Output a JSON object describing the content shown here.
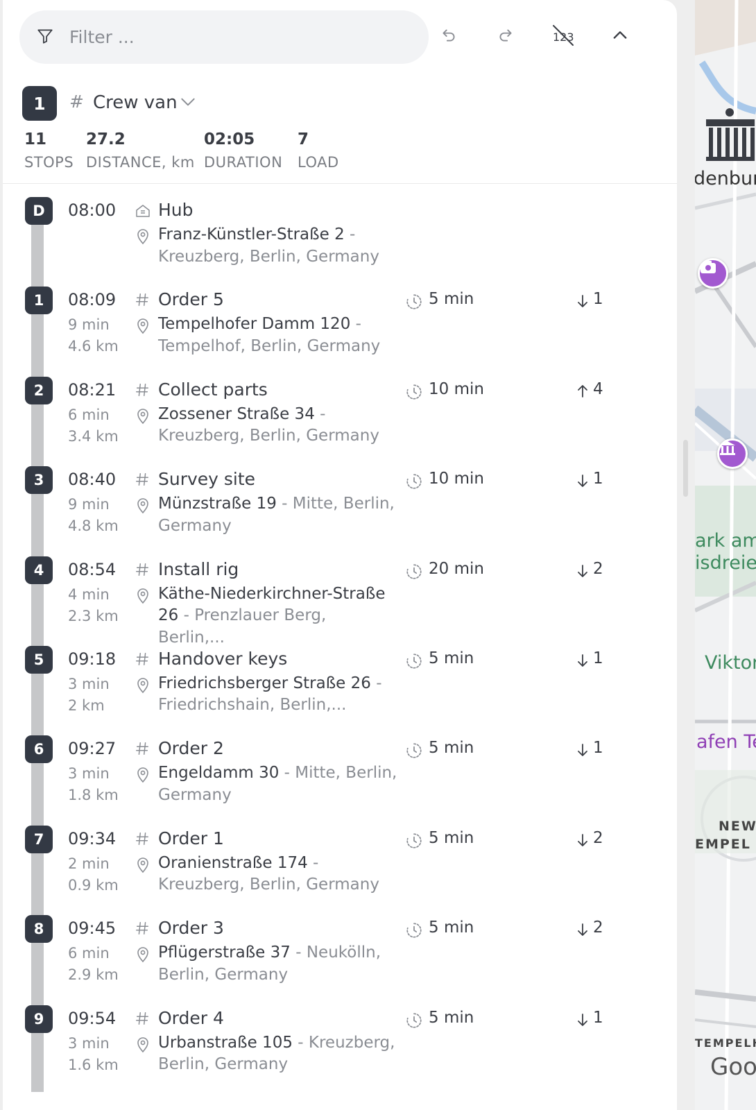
{
  "filter": {
    "placeholder": "Filter ..."
  },
  "toolbar": {
    "undo_icon": "undo-icon",
    "redo_icon": "redo-icon",
    "hide_numbers_icon": "numbers-off-icon",
    "collapse_icon": "chevron-up-icon"
  },
  "vehicle": {
    "index": "1",
    "hash": "#",
    "name": "Crew van",
    "stats": [
      {
        "value": "11",
        "label": "STOPS"
      },
      {
        "value": "27.2",
        "label": "DISTANCE, km"
      },
      {
        "value": "02:05",
        "label": "DURATION"
      },
      {
        "value": "7",
        "label": "LOAD"
      }
    ]
  },
  "stops": [
    {
      "badge": "D",
      "time": "08:00",
      "drive_time": "",
      "drive_dist": "",
      "type": "depot",
      "name": "Hub",
      "addr_main": "Franz-Künstler-Straße 2",
      "addr_rest": " - Kreuzberg, Berlin, Germany",
      "service": "",
      "load_dir": "",
      "load": ""
    },
    {
      "badge": "1",
      "time": "08:09",
      "drive_time": "9 min",
      "drive_dist": "4.6 km",
      "type": "order",
      "name": "Order 5",
      "addr_main": "Tempelhofer Damm 120",
      "addr_rest": " - Tempelhof, Berlin, Germany",
      "service": "5 min",
      "load_dir": "down",
      "load": "1"
    },
    {
      "badge": "2",
      "time": "08:21",
      "drive_time": "6 min",
      "drive_dist": "3.4 km",
      "type": "order",
      "name": "Collect parts",
      "addr_main": "Zossener Straße 34",
      "addr_rest": " - Kreuzberg, Berlin, Germany",
      "service": "10 min",
      "load_dir": "up",
      "load": "4"
    },
    {
      "badge": "3",
      "time": "08:40",
      "drive_time": "9 min",
      "drive_dist": "4.8 km",
      "type": "order",
      "name": "Survey site",
      "addr_main": "Münzstraße 19",
      "addr_rest": " - Mitte, Berlin, Germany",
      "service": "10 min",
      "load_dir": "down",
      "load": "1"
    },
    {
      "badge": "4",
      "time": "08:54",
      "drive_time": "4 min",
      "drive_dist": "2.3 km",
      "type": "order",
      "name": "Install rig",
      "addr_main": "Käthe-Niederkirchner-Straße 26",
      "addr_rest": " - Prenzlauer Berg, Berlin,...",
      "service": "20 min",
      "load_dir": "down",
      "load": "2"
    },
    {
      "badge": "5",
      "time": "09:18",
      "drive_time": "3 min",
      "drive_dist": "2 km",
      "type": "order",
      "name": "Handover keys",
      "addr_main": "Friedrichsberger Straße 26",
      "addr_rest": " - Friedrichshain, Berlin,...",
      "service": "5 min",
      "load_dir": "down",
      "load": "1"
    },
    {
      "badge": "6",
      "time": "09:27",
      "drive_time": "3 min",
      "drive_dist": "1.8 km",
      "type": "order",
      "name": "Order 2",
      "addr_main": "Engeldamm 30",
      "addr_rest": " - Mitte, Berlin, Germany",
      "service": "5 min",
      "load_dir": "down",
      "load": "1"
    },
    {
      "badge": "7",
      "time": "09:34",
      "drive_time": "2 min",
      "drive_dist": "0.9 km",
      "type": "order",
      "name": "Order 1",
      "addr_main": "Oranienstraße 174",
      "addr_rest": " - Kreuzberg, Berlin, Germany",
      "service": "5 min",
      "load_dir": "down",
      "load": "2"
    },
    {
      "badge": "8",
      "time": "09:45",
      "drive_time": "6 min",
      "drive_dist": "2.9 km",
      "type": "order",
      "name": "Order 3",
      "addr_main": "Pflügerstraße 37",
      "addr_rest": " - Neukölln, Berlin, Germany",
      "service": "5 min",
      "load_dir": "down",
      "load": "2"
    },
    {
      "badge": "9",
      "time": "09:54",
      "drive_time": "3 min",
      "drive_dist": "1.6 km",
      "type": "order",
      "name": "Order 4",
      "addr_main": "Urbanstraße 105",
      "addr_rest": " - Kreuzberg, Berlin, Germany",
      "service": "5 min",
      "load_dir": "down",
      "load": "1"
    }
  ],
  "map": {
    "labels": {
      "brandenburg": "denburg",
      "park_line1": "ark am",
      "park_line2": "isdreiec",
      "viktoria": "Viktor",
      "hafen": "afen Te",
      "new_tempel1": "NEW",
      "new_tempel2": "EMPEL",
      "tempelhof": "TEMPELH",
      "google": "Goo"
    },
    "pin_icons": [
      "camera-pin-icon",
      "museum-pin-icon"
    ],
    "landmark_icon": "brandenburg-gate-icon"
  },
  "colors": {
    "badge_bg": "#333944",
    "rail": "#c6c7c9",
    "filter_bg": "#f2f3f5",
    "map_pin": "#a259d0",
    "park_green": "#3d8a5e"
  }
}
